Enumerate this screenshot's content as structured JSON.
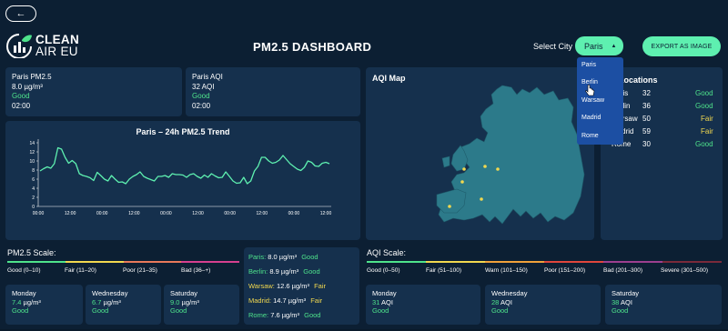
{
  "nav": {
    "back_icon": "arrow-left-icon"
  },
  "brand": {
    "line1": "CLEAN",
    "line2": "AIR EU",
    "logo_icon": "leaf-building-logo",
    "color": "#4ee38b"
  },
  "header": {
    "title": "PM2.5 DASHBOARD",
    "select_label": "Select City",
    "selected_city": "Paris",
    "export_label": "EXPORT AS IMAGE",
    "accent_color": "#5ef0b0"
  },
  "dropdown": {
    "options": [
      "Paris",
      "Berlin",
      "Warsaw",
      "Madrid",
      "Rome"
    ],
    "hovered": "Berlin",
    "bg_color": "#1c4fa3"
  },
  "pm25_card": {
    "title": "Paris PM2.5",
    "value": "8.0 µg/m³",
    "status": "Good",
    "time": "02:00"
  },
  "aqi_card": {
    "title": "Paris AQI",
    "value": "32 AQI",
    "status": "Good",
    "time": "02:00"
  },
  "map": {
    "title": "AQI Map"
  },
  "locations": {
    "title": "Locations",
    "rows": [
      {
        "city": "Paris",
        "aqi": "32",
        "status": "Good"
      },
      {
        "city": "Berlin",
        "aqi": "36",
        "status": "Good"
      },
      {
        "city": "Warsaw",
        "aqi": "50",
        "status": "Fair"
      },
      {
        "city": "Madrid",
        "aqi": "59",
        "status": "Fair"
      },
      {
        "city": "Rome",
        "aqi": "30",
        "status": "Good"
      }
    ]
  },
  "chart_data": {
    "type": "line",
    "title": "Paris – 24h PM2.5 Trend",
    "y_ticks": [
      "0",
      "2",
      "4",
      "6",
      "8",
      "10",
      "12",
      "14"
    ],
    "x_ticks": [
      "00:00",
      "12:00",
      "00:00",
      "12:00",
      "00:00",
      "12:00",
      "00:00",
      "12:00",
      "00:00",
      "12:00"
    ],
    "ylim": [
      0,
      14
    ],
    "color": "#5ef0b0",
    "series": [
      {
        "values": [
          7.8,
          8.3,
          8.7,
          8.4,
          9.4,
          12.9,
          12.6,
          10.8,
          9.5,
          10.1,
          9.4,
          7.2,
          6.8,
          6.6,
          6.3,
          5.7,
          7.5,
          6.8,
          6.0,
          5.6,
          6.8,
          6.0,
          5.3,
          5.4,
          5.0,
          6.0,
          6.6,
          7.0,
          7.6,
          6.6,
          6.2,
          5.9,
          5.6,
          6.6,
          6.6,
          6.8,
          6.4,
          7.2,
          7.0,
          7.0,
          6.9,
          6.4,
          7.0,
          7.2,
          6.6,
          6.2,
          6.9,
          6.4,
          7.2,
          6.7,
          6.3,
          6.4,
          7.6,
          6.6,
          5.6,
          5.1,
          5.2,
          6.4,
          5.0,
          5.6,
          7.8,
          8.8,
          10.8,
          10.8,
          10.0,
          9.5,
          9.7,
          10.2,
          11.2,
          10.3,
          9.4,
          8.8,
          8.2,
          7.9,
          8.6,
          10.0,
          9.7,
          8.9,
          8.8,
          9.5,
          9.7,
          9.4
        ]
      }
    ]
  },
  "pm_scale": {
    "title": "PM2.5 Scale:",
    "labels": [
      "Good (0–10)",
      "Fair (11–20)",
      "Poor (21–35)",
      "Bad (36–+)"
    ],
    "colors": [
      "#4ee38b",
      "#f1d84f",
      "#e8795a",
      "#d6408f"
    ]
  },
  "pm_forecast": [
    {
      "day": "Monday",
      "value": "7.4",
      "unit": "µg/m³",
      "status": "Good"
    },
    {
      "day": "Wednesday",
      "value": "6.7",
      "unit": "µg/m³",
      "status": "Good"
    },
    {
      "day": "Saturday",
      "value": "9.0",
      "unit": "µg/m³",
      "status": "Good"
    }
  ],
  "city_list": [
    {
      "city": "Paris:",
      "value": "8.0 µg/m³",
      "status": "Good",
      "level": "good"
    },
    {
      "city": "Berlin:",
      "value": "8.9 µg/m³",
      "status": "Good",
      "level": "good"
    },
    {
      "city": "Warsaw:",
      "value": "12.6 µg/m³",
      "status": "Fair",
      "level": "fair"
    },
    {
      "city": "Madrid:",
      "value": "14.7 µg/m³",
      "status": "Fair",
      "level": "fair"
    },
    {
      "city": "Rome:",
      "value": "7.6 µg/m³",
      "status": "Good",
      "level": "good"
    }
  ],
  "aqi_scale": {
    "title": "AQI Scale:",
    "labels": [
      "Good (0–50)",
      "Fair (51–100)",
      "Warn (101–150)",
      "Poor (151–200)",
      "Bad (201–300)",
      "Severe (301–500)"
    ],
    "colors": [
      "#4ee38b",
      "#f1d84f",
      "#f0a13a",
      "#e0463c",
      "#9c3f8f",
      "#7a2a3a"
    ]
  },
  "aqi_forecast": [
    {
      "day": "Monday",
      "value": "31",
      "unit": "AQI",
      "status": "Good"
    },
    {
      "day": "Wednesday",
      "value": "28",
      "unit": "AQI",
      "status": "Good"
    },
    {
      "day": "Saturday",
      "value": "38",
      "unit": "AQI",
      "status": "Good"
    }
  ]
}
